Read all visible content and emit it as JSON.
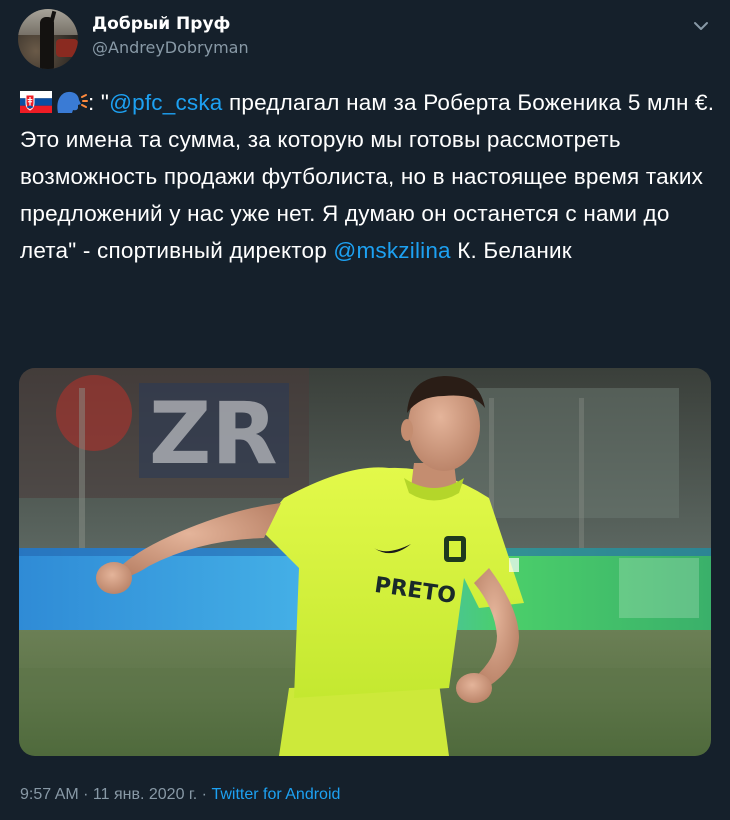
{
  "author": {
    "display_name": "Добрый Пруф",
    "handle": "@AndreyDobryman"
  },
  "icons": {
    "menu": "chevron-down-icon",
    "emoji_flag": "slovakia-flag-emoji",
    "emoji_speaker": "speaking-head-emoji"
  },
  "tweet": {
    "colon_after_emoji": ": \"",
    "mention_1": "@pfc_cska",
    "text_1": " предлагал нам за Роберта Боженика 5 млн €. Это имена та сумма, за которую мы готовы рассмотреть возможность продажи футболиста, но в настоящее время таких предложений у нас уже нет. Я думаю он останется с нами до лета\" - спортивный директор ",
    "mention_2": "@mskzilina",
    "text_2": " К. Беланик"
  },
  "media": {
    "alt": "player photo",
    "shirt_text": "PRETO",
    "board_text": "ZR"
  },
  "meta": {
    "time": "9:57 AM",
    "sep1": " · ",
    "date": "11 янв. 2020 г.",
    "sep2": " · ",
    "source": "Twitter for Android"
  },
  "colors": {
    "background": "#15202b",
    "link": "#1da1f2",
    "muted": "#8899a6",
    "shirt": "#d6f23a"
  }
}
